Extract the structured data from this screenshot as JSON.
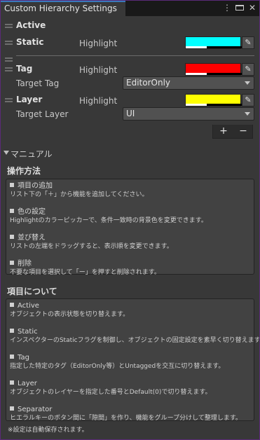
{
  "window": {
    "tab_title": "Custom Hierarchy Settings",
    "icons": [
      "more-icon",
      "maximize-icon",
      "close-icon"
    ]
  },
  "settings": {
    "active_label": "Active",
    "static_label": "Static",
    "static_highlight_label": "Highlight",
    "static_color": "#00ffff",
    "tag_label": "Tag",
    "tag_highlight_label": "Highlight",
    "tag_color": "#ff0000",
    "target_tag_label": "Target Tag",
    "target_tag_value": "EditorOnly",
    "layer_label": "Layer",
    "layer_highlight_label": "Highlight",
    "layer_color": "#ffff00",
    "target_layer_label": "Target Layer",
    "target_layer_value": "UI"
  },
  "toolbar": {
    "add_label": "+",
    "remove_label": "−"
  },
  "manual": {
    "fold_label": "マニュアル",
    "operations_title": "操作方法",
    "operations": [
      {
        "title": "項目の追加",
        "body": "リスト下の「＋」から機能を追加してください。"
      },
      {
        "title": "色の設定",
        "body": "Highlightのカラーピッカーで、条件一致時の背景色を変更できます。"
      },
      {
        "title": "並び替え",
        "body": "リストの左端をドラッグすると、表示順を変更できます。"
      },
      {
        "title": "削除",
        "body": "不要な項目を選択して「ー」を押すと削除されます。"
      }
    ],
    "items_title": "項目について",
    "items": [
      {
        "title": "Active",
        "body": "オブジェクトの表示状態を切り替えます。"
      },
      {
        "title": "Static",
        "body": "インスペクターのStaticフラグを制御し、オブジェクトの固定設定を素早く切り替えます。"
      },
      {
        "title": "Tag",
        "body": "指定した特定のタグ（EditorOnly等）とUntaggedを交互に切り替えます。"
      },
      {
        "title": "Layer",
        "body": "オブジェクトのレイヤーを指定した番号とDefault(0)で切り替えます。"
      },
      {
        "title": "Separator",
        "body": "ヒエラルキーのボタン間に「隙間」を作り、機能をグループ分けして整理します。"
      }
    ],
    "footer": "※設定は自動保存されます。"
  }
}
